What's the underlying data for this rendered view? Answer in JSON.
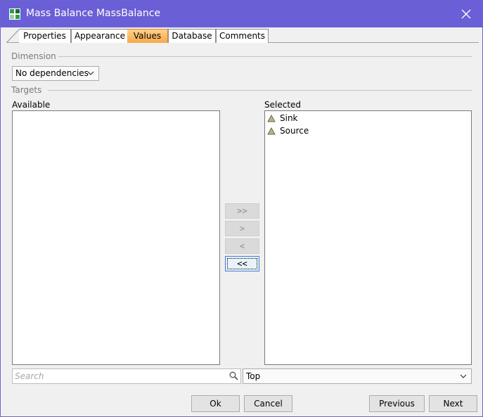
{
  "window": {
    "title": "Mass Balance MassBalance"
  },
  "tabs": [
    {
      "label": "Properties"
    },
    {
      "label": "Appearance"
    },
    {
      "label": "Values"
    },
    {
      "label": "Database"
    },
    {
      "label": "Comments"
    }
  ],
  "active_tab": "Values",
  "dimension": {
    "section_label": "Dimension",
    "selected": "No dependencies"
  },
  "targets": {
    "section_label": "Targets",
    "available_label": "Available",
    "available_items": [],
    "selected_label": "Selected",
    "selected_items": [
      {
        "label": "Sink"
      },
      {
        "label": "Source"
      }
    ]
  },
  "move_buttons": {
    "add_all": ">>",
    "add": ">",
    "remove": "<",
    "remove_all": "<<"
  },
  "search": {
    "placeholder": "Search"
  },
  "position_select": {
    "selected": "Top"
  },
  "footer": {
    "ok": "Ok",
    "cancel": "Cancel",
    "previous": "Previous",
    "next": "Next"
  },
  "colors": {
    "titlebar": "#6a5fd6",
    "active_tab": "#f7a94a",
    "focus_border": "#3b7fd6"
  }
}
